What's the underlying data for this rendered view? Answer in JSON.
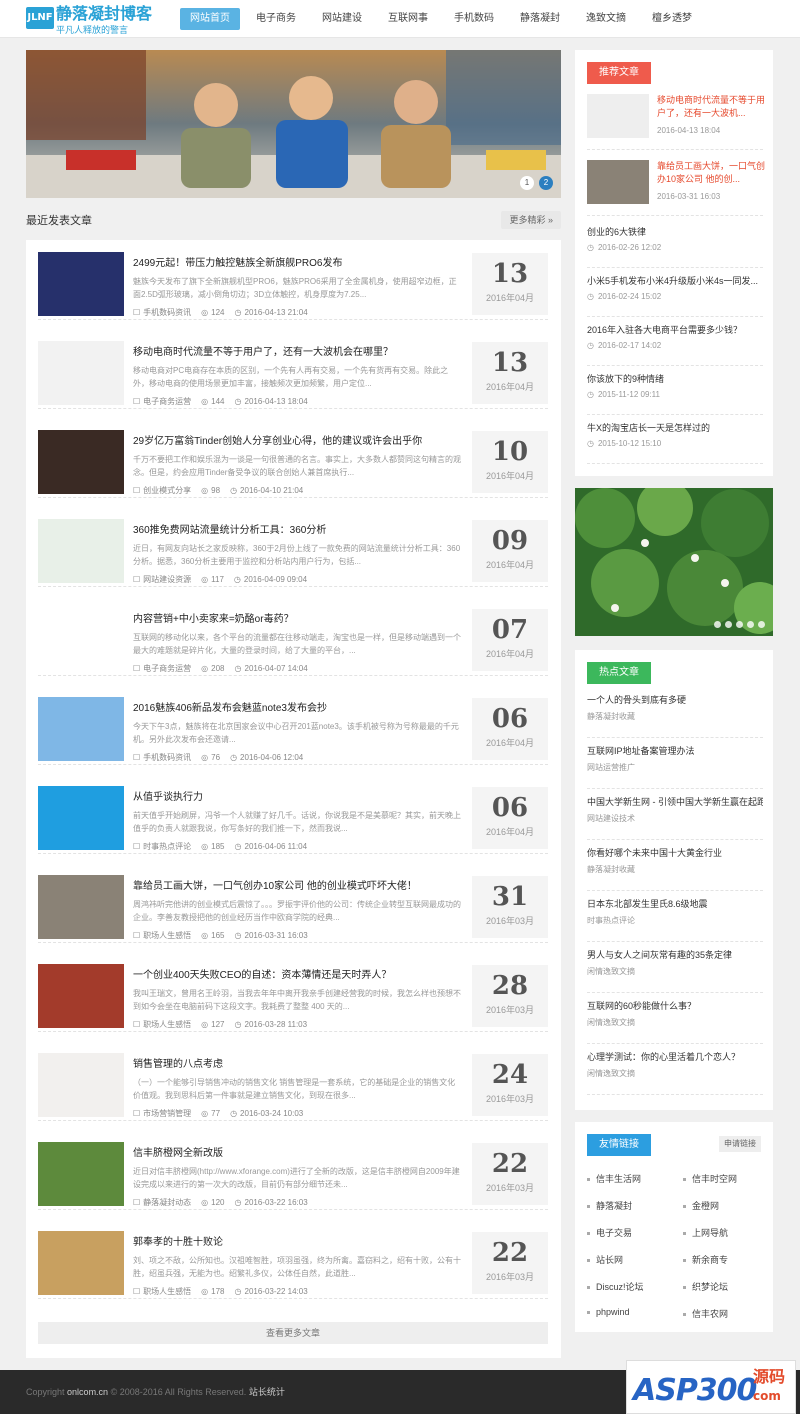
{
  "header": {
    "logo_mark": "JLNF",
    "logo_name": "静落凝封博客",
    "logo_sub": "平凡人释放的警言",
    "nav": [
      "网站首页",
      "电子商务",
      "网站建设",
      "互联网事",
      "手机数码",
      "静落凝封",
      "逸致文摘",
      "檀乡透梦"
    ],
    "active_index": 0
  },
  "banner": {
    "dots": [
      "1",
      "2"
    ],
    "active_dot": 1
  },
  "recent": {
    "title": "最近发表文章",
    "more": "更多精彩 »",
    "load_more": "查看更多文章",
    "items": [
      {
        "title": "2499元起！带压力触控魅族全新旗舰PRO6发布",
        "desc": "魅族今天发布了旗下全新旗舰机型PRO6，魅族PRO6采用了全金属机身，使用超窄边框，正面2.5D弧形玻璃，减小倒角切边；3D立体触控，机身厚度为7.25...",
        "category": "手机数码资讯",
        "views": "124",
        "datetime": "2016-04-13 21:04",
        "day": "13",
        "month": "2016年04月",
        "thumb_color": "#26306b"
      },
      {
        "title": "移动电商时代流量不等于用户了，还有一大波机会在哪里？",
        "desc": "移动电商对PC电商存在本质的区别，一个先有人再有交易，一个先有货再有交易。除此之外，移动电商的使用场景更加丰富，接触频次更加频繁，用户定位...",
        "category": "电子商务运营",
        "views": "144",
        "datetime": "2016-04-13 18:04",
        "day": "13",
        "month": "2016年04月",
        "thumb_color": "#f2f2f2"
      },
      {
        "title": "29岁亿万富翁Tinder创始人分享创业心得，他的建议或许会出乎你",
        "desc": "千万不要把工作和娱乐混为一谈是一句很普通的名言。事实上，大多数人都赞同这句精言的观念。但是，约会应用Tinder备受争议的联合创始人兼首席执行...",
        "category": "创业模式分享",
        "views": "98",
        "datetime": "2016-04-10 21:04",
        "day": "10",
        "month": "2016年04月",
        "thumb_color": "#3a2a24"
      },
      {
        "title": "360推免费网站流量统计分析工具：360分析",
        "desc": "近日，有网友向站长之家反映称，360于2月份上线了一款免费的网站流量统计分析工具：360分析。据悉，360分析主要用于监控和分析站内用户行为，包括...",
        "category": "网站建设资源",
        "views": "117",
        "datetime": "2016-04-09 09:04",
        "day": "09",
        "month": "2016年04月",
        "thumb_color": "#e8f0e8"
      },
      {
        "title": "内容营销+中小卖家来=奶酪or毒药？",
        "desc": "互联网的移动化以来，各个平台的流量都在往移动端走，淘宝也是一样，但是移动端遇到一个最大的难题就是碎片化，大量的登录时间，给了大量的平台，...",
        "category": "电子商务运营",
        "views": "208",
        "datetime": "2016-04-07 14:04",
        "day": "07",
        "month": "2016年04月",
        "thumb_color": "#ffffff"
      },
      {
        "title": "2016魅族406新品发布会魅蓝note3发布会抄",
        "desc": "今天下午3点，魅族将在北京国家会议中心召开201蓝note3。该手机被号称为号称最最的千元机。另外此次发布会还邀请...",
        "category": "手机数码资讯",
        "views": "76",
        "datetime": "2016-04-06 12:04",
        "day": "06",
        "month": "2016年04月",
        "thumb_color": "#7fb7e6"
      },
      {
        "title": "从值乎谈执行力",
        "desc": "前天值乎开始刷屏，冯爷一个人就赚了好几千。话说，你说我是不是美慕呢？其实，前天晚上值乎的负责人就跟我说，你写条好的我们推一下，然而我说...",
        "category": "时事热点评论",
        "views": "185",
        "datetime": "2016-04-06 11:04",
        "day": "06",
        "month": "2016年04月",
        "thumb_color": "#1f9ee0"
      },
      {
        "title": "靠给员工画大饼，一口气创办10家公司 他的创业模式吓坏大佬！",
        "desc": "周鸿祎听完他讲的创业模式后震惊了。。。罗振宇评价他的公司：传统企业转型互联网最成功的企业。李善友教授把他的创业经历当作中欧商学院的经典...",
        "category": "职场人生感悟",
        "views": "165",
        "datetime": "2016-03-31 16:03",
        "day": "31",
        "month": "2016年03月",
        "thumb_color": "#8a8276"
      },
      {
        "title": "一个创业400天失败CEO的自述：资本薄情还是天时弄人？",
        "desc": "我叫王瑞文，曾用名王岭羽，当我去年年中离开我亲手创建经营我的时候，我怎么样也预想不到如今会坐在电脑前码下这段文字。我耗费了整整 400 天的...",
        "category": "职场人生感悟",
        "views": "127",
        "datetime": "2016-03-28 11:03",
        "day": "28",
        "month": "2016年03月",
        "thumb_color": "#a33b2b"
      },
      {
        "title": "销售管理的八点考虑",
        "desc": "（一）一个能够引导销售冲动的销售文化 销售管理是一套系统，它的基础是企业的销售文化价值观。我到思科后第一件事就是建立销售文化，到现在很多...",
        "category": "市场营销管理",
        "views": "77",
        "datetime": "2016-03-24 10:03",
        "day": "24",
        "month": "2016年03月",
        "thumb_color": "#f2f0ee"
      },
      {
        "title": "信丰脐橙网全新改版",
        "desc": "近日对信丰脐橙网(http://www.xforange.com)进行了全新的改版，这是信丰脐橙网自2009年建设完成以来进行的第一次大的改版，目前仍有部分细节还未...",
        "category": "静落凝封动态",
        "views": "120",
        "datetime": "2016-03-22 16:03",
        "day": "22",
        "month": "2016年03月",
        "thumb_color": "#5d8a3c"
      },
      {
        "title": "郭奉孝的十胜十败论",
        "desc": "刘、项之不敌，公所知也。汉祖唯智胜，项羽虽强，终为所禽。嘉窃料之，绍有十败，公有十胜，绍虽兵强，无能为也。绍繁礼多仪，公体任自然，此道胜...",
        "category": "职场人生感悟",
        "views": "178",
        "datetime": "2016-03-22 14:03",
        "day": "22",
        "month": "2016年03月",
        "thumb_color": "#c8a060"
      }
    ]
  },
  "sidebar": {
    "recommend": {
      "tag": "推荐文章",
      "with_thumb": [
        {
          "title": "移动电商时代流量不等于用户了，还有一大波机...",
          "date": "2016-04-13 18:04",
          "thumb_color": "#eeeeee"
        },
        {
          "title": "靠给员工画大饼，一口气创办10家公司 他的创...",
          "date": "2016-03-31 16:03",
          "thumb_color": "#8a8276"
        }
      ],
      "plain": [
        {
          "title": "创业的6大铁律",
          "date": "2016-02-26 12:02"
        },
        {
          "title": "小米5手机发布小米4升级版小米4s一同发...",
          "date": "2016-02-24 15:02"
        },
        {
          "title": "2016年入驻各大电商平台需要多少钱？",
          "date": "2016-02-17 14:02"
        },
        {
          "title": "你该放下的9种情绪",
          "date": "2015-11-12 09:11"
        },
        {
          "title": "牛X的淘宝店长一天是怎样过的",
          "date": "2015-10-12 15:10"
        }
      ]
    },
    "hot": {
      "tag": "热点文章",
      "items": [
        {
          "title": "一个人的骨头到底有多硬",
          "category": "静落凝封收藏"
        },
        {
          "title": "互联网IP地址备案管理办法",
          "category": "网站运营推广"
        },
        {
          "title": "中国大学新生网 - 引领中国大学新生赢在起跑线",
          "category": "网站建设技术"
        },
        {
          "title": "你看好哪个未来中国十大黄金行业",
          "category": "静落凝封收藏"
        },
        {
          "title": "日本东北部发生里氏8.6级地震",
          "category": "时事热点评论"
        },
        {
          "title": "男人与女人之间灰常有趣的35条定律",
          "category": "闲情逸致文摘"
        },
        {
          "title": "互联网的60秒能做什么事？",
          "category": "闲情逸致文摘"
        },
        {
          "title": "心理学测试：你的心里活着几个恋人？",
          "category": "闲情逸致文摘"
        }
      ]
    },
    "links": {
      "tag": "友情链接",
      "apply": "申请链接",
      "items": [
        "信丰生活网",
        "信丰时空网",
        "静落凝封",
        "金橙网",
        "电子交易",
        "上网导航",
        "站长网",
        "新余商专",
        "Discuz!论坛",
        "织梦论坛",
        "phpwind",
        "信丰农网"
      ]
    }
  },
  "footer": {
    "prefix": "Copyright",
    "site": "onlcom.cn",
    "rights": "© 2008-2016 All Rights Reserved.",
    "stats": "站长统计"
  },
  "watermark": {
    "brand": "ASP300",
    "tag1": "源码",
    "tag2": "com"
  },
  "colors": {
    "accent": "#5ab3e3",
    "recommend_tag": "#ef5b4c",
    "hot_tag": "#3cb85c",
    "links_tag": "#2c9ee0"
  }
}
